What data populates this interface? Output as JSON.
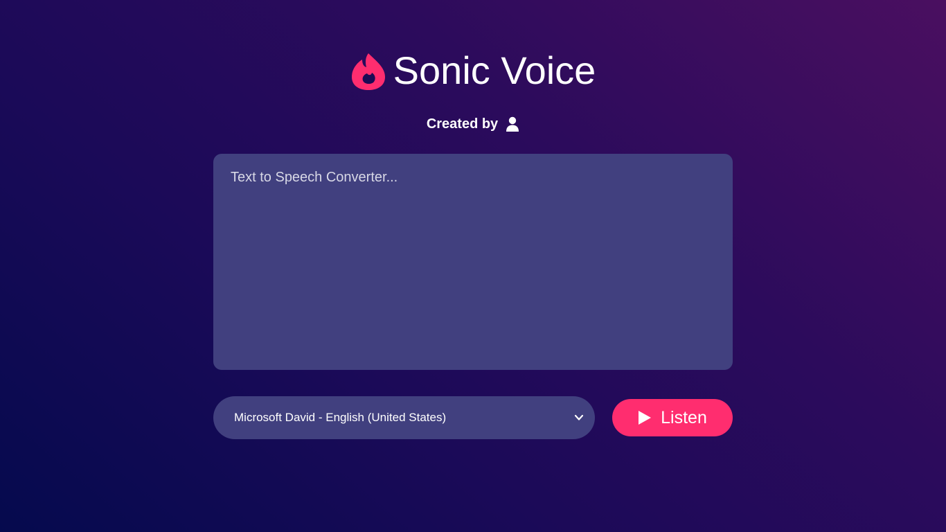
{
  "app": {
    "title": "Sonic Voice",
    "logo_icon": "flame-icon",
    "brand_color": "#ff2d6f"
  },
  "credit": {
    "label": "Created by",
    "icon": "user-icon"
  },
  "editor": {
    "placeholder": "Text to Speech Converter...",
    "value": ""
  },
  "voice": {
    "selected": "Microsoft David - English (United States)",
    "icon": "chevron-down-icon"
  },
  "listen": {
    "label": "Listen",
    "icon": "play-icon"
  },
  "colors": {
    "panel": "#41407f",
    "accent": "#ff2d6f",
    "background_start": "#050a4e",
    "background_end": "#4a0f60"
  }
}
